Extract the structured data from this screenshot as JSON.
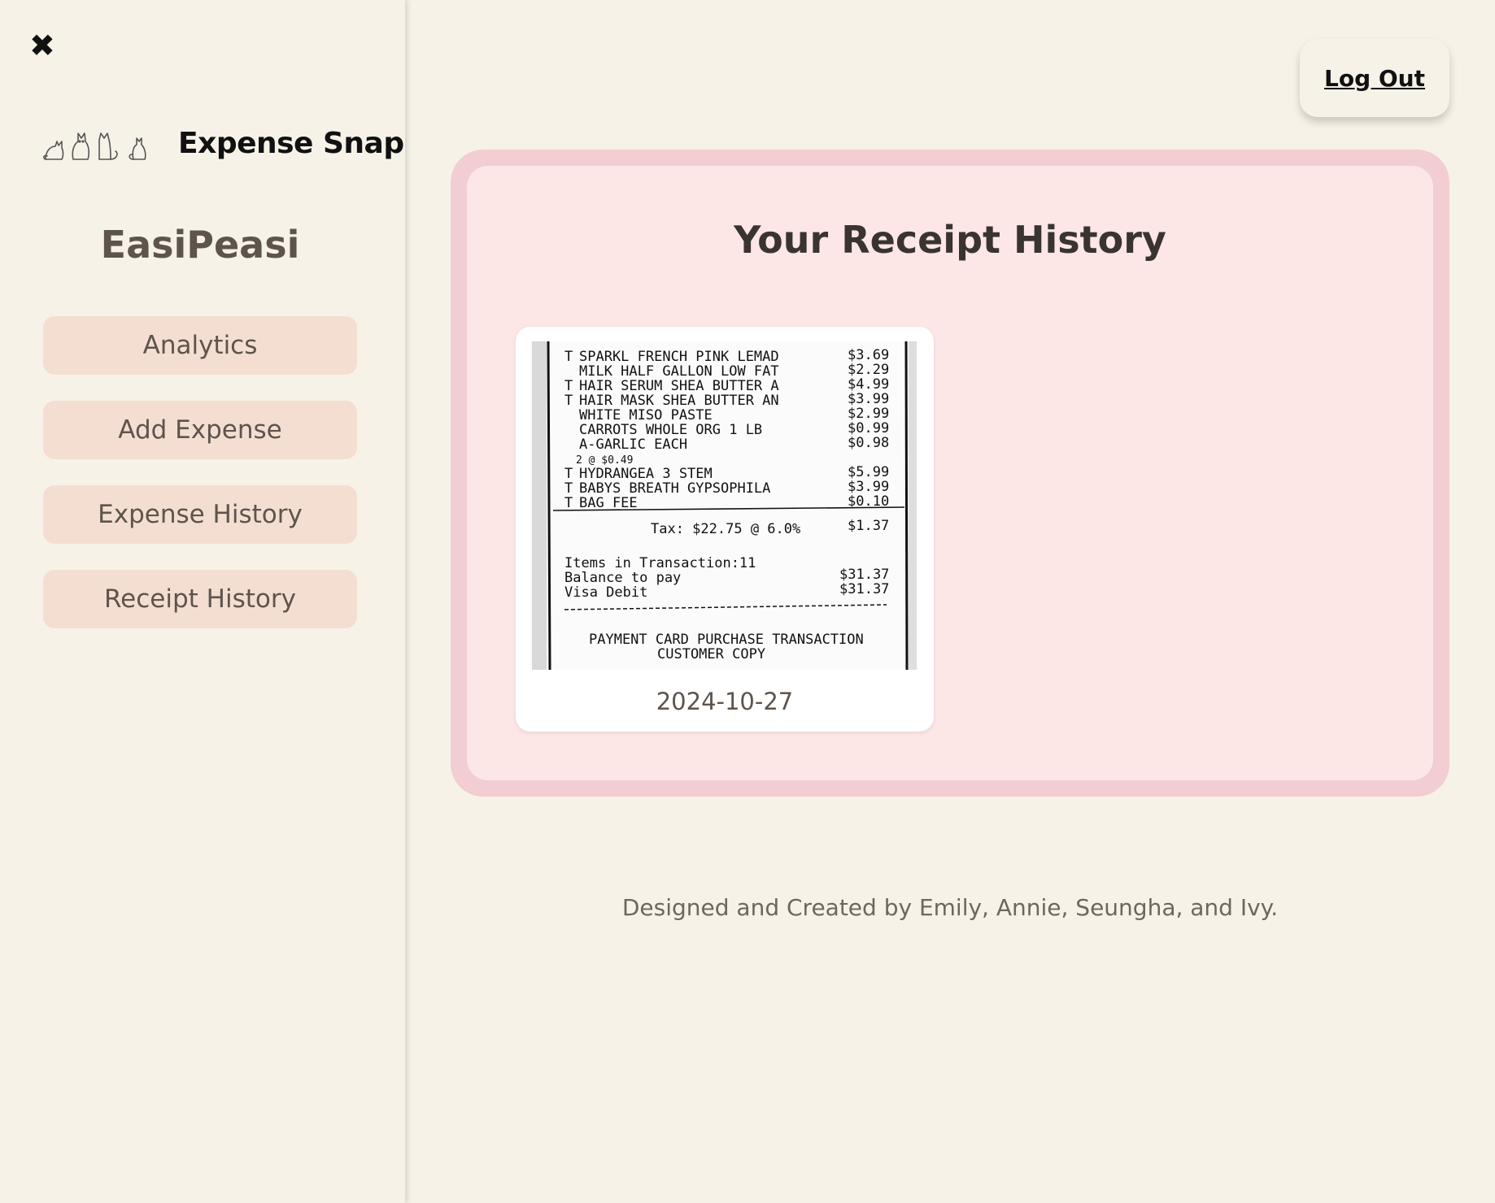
{
  "sidebar": {
    "brand_name": "Expense Snap",
    "user_name": "EasiPeasi",
    "nav": [
      {
        "label": "Analytics"
      },
      {
        "label": "Add Expense"
      },
      {
        "label": "Expense History"
      },
      {
        "label": "Receipt History"
      }
    ]
  },
  "header": {
    "logout_label": "Log Out"
  },
  "main": {
    "title": "Your Receipt History",
    "receipts": [
      {
        "date": "2024-10-27",
        "lines": [
          {
            "prefix": "T",
            "item": "SPARKL FRENCH PINK LEMAD",
            "price": "$3.69"
          },
          {
            "prefix": "",
            "item": "MILK HALF GALLON LOW FAT",
            "price": "$2.29"
          },
          {
            "prefix": "T",
            "item": "HAIR SERUM SHEA BUTTER A",
            "price": "$4.99"
          },
          {
            "prefix": "T",
            "item": "HAIR MASK SHEA BUTTER AN",
            "price": "$3.99"
          },
          {
            "prefix": "",
            "item": "WHITE MISO PASTE",
            "price": "$2.99"
          },
          {
            "prefix": "",
            "item": "CARROTS WHOLE ORG 1 LB",
            "price": "$0.99"
          },
          {
            "prefix": "",
            "item": "A-GARLIC EACH",
            "price": "$0.98"
          },
          {
            "prefix": "",
            "item": "2 @ $0.49",
            "price": ""
          },
          {
            "prefix": "T",
            "item": "HYDRANGEA 3 STEM",
            "price": "$5.99"
          },
          {
            "prefix": "T",
            "item": "BABYS BREATH GYPSOPHILA",
            "price": "$3.99"
          },
          {
            "prefix": "T",
            "item": "BAG FEE",
            "price": "$0.10"
          }
        ],
        "tax_line": "Tax:   $22.75 @ 6.0%",
        "tax_amount": "$1.37",
        "items_line": "Items in Transaction:11",
        "balance_label": "Balance to pay",
        "balance_amount": "$31.37",
        "visa_label": "Visa Debit",
        "visa_amount": "$31.37",
        "footer_line1": "PAYMENT CARD PURCHASE TRANSACTION",
        "footer_line2": "CUSTOMER COPY"
      }
    ]
  },
  "footer": {
    "credit": "Designed and Created by Emily, Annie, Seungha, and Ivy."
  }
}
